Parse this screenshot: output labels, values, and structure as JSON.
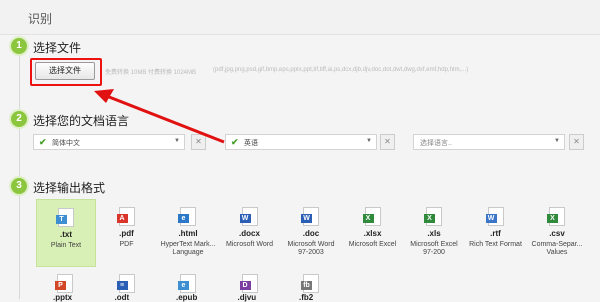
{
  "header": {
    "title": "识别"
  },
  "step1": {
    "number": "1",
    "title": "选择文件",
    "button_label": "选择文件",
    "limit_text": "免费转换 10MB 付费转换 1024MB",
    "formats_text": "(pdf,jpg,png,psd,gif,bmp,eps,pptx,ppt,tif,tiff,ai,ps,dcx,djb,djv,doc,dot,dwt,dwg,dxf,emf,hdp,htm,...)"
  },
  "step2": {
    "number": "2",
    "title": "选择您的文档语言",
    "languages": [
      {
        "label": "简体中文",
        "checked": true
      },
      {
        "label": "英语",
        "checked": true
      },
      {
        "label": "选择语言..",
        "checked": false
      }
    ],
    "clear_symbol": "✕"
  },
  "step3": {
    "number": "3",
    "title": "选择输出格式",
    "formats": [
      {
        "ext": ".txt",
        "desc": "Plain Text",
        "icon": "txt-file-icon",
        "badge": "T",
        "color": "#3d8fd1",
        "selected": true
      },
      {
        "ext": ".pdf",
        "desc": "PDF",
        "icon": "pdf-file-icon",
        "badge": "A",
        "color": "#d9352b",
        "selected": false
      },
      {
        "ext": ".html",
        "desc": "HyperText Mark... Language",
        "icon": "html-file-icon",
        "badge": "e",
        "color": "#2b78c8",
        "selected": false
      },
      {
        "ext": ".docx",
        "desc": "Microsoft Word",
        "icon": "word-file-icon",
        "badge": "W",
        "color": "#2b5fb5",
        "selected": false
      },
      {
        "ext": ".doc",
        "desc": "Microsoft Word 97-2003",
        "icon": "word-file-icon",
        "badge": "W",
        "color": "#2b5fb5",
        "selected": false
      },
      {
        "ext": ".xlsx",
        "desc": "Microsoft Excel",
        "icon": "excel-file-icon",
        "badge": "X",
        "color": "#2f8a3c",
        "selected": false
      },
      {
        "ext": ".xls",
        "desc": "Microsoft Excel 97-200",
        "icon": "excel-file-icon",
        "badge": "X",
        "color": "#2f8a3c",
        "selected": false
      },
      {
        "ext": ".rtf",
        "desc": "Rich Text Format",
        "icon": "rtf-file-icon",
        "badge": "W",
        "color": "#3a75c9",
        "selected": false
      },
      {
        "ext": ".csv",
        "desc": "Comma-Separ... Values",
        "icon": "csv-file-icon",
        "badge": "X",
        "color": "#2f8a3c",
        "selected": false
      }
    ],
    "row2": [
      {
        "ext": ".pptx",
        "icon": "powerpoint-file-icon",
        "badge": "P",
        "color": "#d24726"
      },
      {
        "ext": ".odt",
        "icon": "odt-file-icon",
        "badge": "≡",
        "color": "#2b5fb5"
      },
      {
        "ext": ".epub",
        "icon": "epub-file-icon",
        "badge": "e",
        "color": "#3d8fd1"
      },
      {
        "ext": ".djvu",
        "icon": "djvu-file-icon",
        "badge": "D",
        "color": "#7a3fa0"
      },
      {
        "ext": ".fb2",
        "icon": "fb2-file-icon",
        "badge": "fb",
        "color": "#777777"
      }
    ]
  },
  "colors": {
    "accent_green": "#8cc63f",
    "highlight_red": "#e11111"
  }
}
